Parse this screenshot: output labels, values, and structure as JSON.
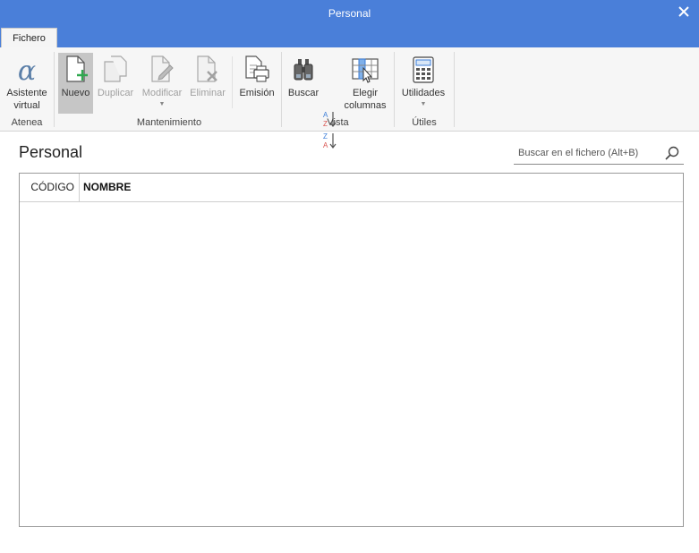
{
  "window": {
    "title": "Personal"
  },
  "tabs": [
    {
      "label": "Fichero"
    }
  ],
  "ribbon": {
    "atenea": {
      "label": "Atenea",
      "asistente": {
        "line1": "Asistente",
        "line2": "virtual"
      }
    },
    "mantenimiento": {
      "label": "Mantenimiento",
      "nuevo": "Nuevo",
      "duplicar": "Duplicar",
      "modificar": "Modificar",
      "eliminar": "Eliminar",
      "emision": "Emisión"
    },
    "vista": {
      "label": "Vista",
      "buscar": "Buscar",
      "elegir": {
        "line1": "Elegir",
        "line2": "columnas"
      }
    },
    "utiles": {
      "label": "Útiles",
      "utilidades": "Utilidades"
    }
  },
  "page": {
    "title": "Personal"
  },
  "search": {
    "placeholder": "Buscar en el fichero (Alt+B)",
    "value": ""
  },
  "table": {
    "columns": [
      {
        "label": "CÓDIGO"
      },
      {
        "label": "NOMBRE"
      }
    ],
    "rows": []
  },
  "colors": {
    "titlebar": "#4a7fd9",
    "ribbon_bg": "#f6f6f6",
    "active_button": "#c6c6c6",
    "accent_green": "#2fa84f",
    "sort_blue": "#3b7dd8",
    "sort_red": "#d9534f"
  }
}
